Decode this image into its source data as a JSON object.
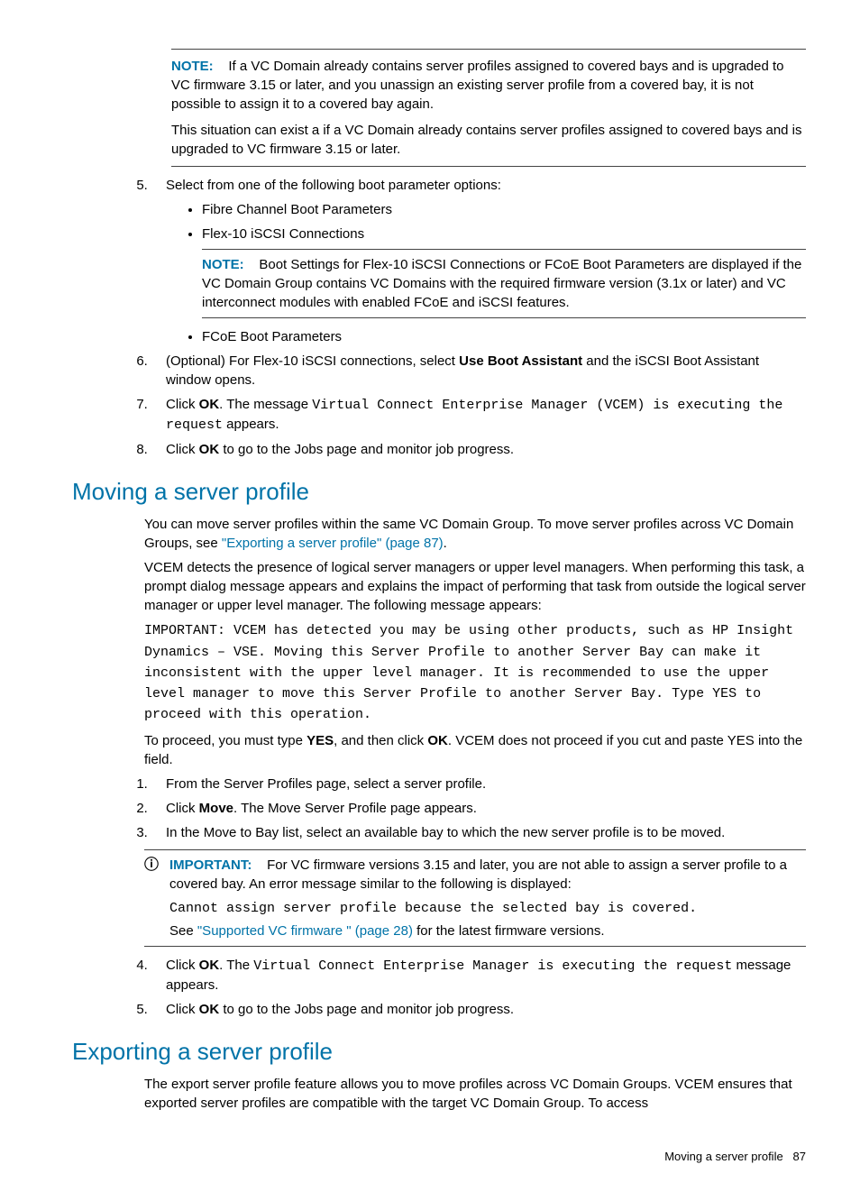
{
  "note1": {
    "label": "NOTE:",
    "p1_a": "If a VC Domain already contains server profiles assigned to covered bays and is upgraded to VC firmware 3.15 or later, and you unassign an existing server profile from a covered bay, it is not possible to assign it to a covered bay again.",
    "p2": "This situation can exist a if a VC Domain already contains server profiles assigned to covered bays and is upgraded to VC firmware 3.15 or later."
  },
  "step5": {
    "intro": "Select from one of the following boot parameter options:",
    "b1": "Fibre Channel Boot Parameters",
    "b2": "Flex-10 iSCSI Connections",
    "note_label": "NOTE:",
    "note_text": "Boot Settings for Flex-10 iSCSI Connections or FCoE Boot Parameters are displayed if the VC Domain Group contains VC Domains with the required firmware version (3.1x or later) and VC interconnect modules with enabled FCoE and iSCSI features.",
    "b3": "FCoE Boot Parameters"
  },
  "step6_a": "(Optional) For Flex-10 iSCSI connections, select ",
  "step6_b": "Use Boot Assistant",
  "step6_c": " and the iSCSI Boot Assistant window opens.",
  "step7_a": "Click ",
  "step7_ok": "OK",
  "step7_b": ". The message ",
  "step7_mono": "Virtual Connect Enterprise Manager (VCEM) is executing the request",
  "step7_c": " appears.",
  "step8_a": "Click ",
  "step8_b": " to go to the Jobs page and monitor job progress.",
  "moving": {
    "title": "Moving a server profile",
    "p1_a": "You can move server profiles within the same VC Domain Group. To move server profiles across VC Domain Groups, see ",
    "p1_link": "\"Exporting a server profile\" (page 87)",
    "p1_b": ".",
    "p2": "VCEM detects the presence of logical server managers or upper level managers. When performing this task, a prompt dialog message appears and explains the impact of performing that task from outside the logical server manager or upper level manager. The following message appears:",
    "mono": "IMPORTANT: VCEM has detected you may be using other products, such as HP Insight Dynamics – VSE. Moving this Server Profile to another Server Bay can make it inconsistent with the upper level manager. It is recommended to use the upper level manager to move this Server Profile to another Server Bay. Type YES to proceed with this operation.",
    "p3_a": "To proceed, you must type ",
    "p3_yes": "YES",
    "p3_b": ", and then click ",
    "p3_ok": "OK",
    "p3_c": ". VCEM does not proceed if you cut and paste YES into the field.",
    "s1": "From the Server Profiles page, select a server profile.",
    "s2_a": "Click ",
    "s2_b": "Move",
    "s2_c": ". The Move Server Profile page appears.",
    "s3": "In the Move to Bay list, select an available bay to which the new server profile is to be moved.",
    "imp_label": "IMPORTANT:",
    "imp_p1": "For VC firmware versions 3.15 and later, you are not able to assign a server profile to a covered bay. An error message similar to the following is displayed:",
    "imp_mono": "Cannot assign server profile because the selected bay is covered.",
    "imp_p2_a": "See ",
    "imp_link": "\"Supported VC firmware \" (page 28)",
    "imp_p2_b": " for the latest firmware versions.",
    "s4_a": "Click ",
    "s4_ok": "OK",
    "s4_b": ". The ",
    "s4_mono": "Virtual Connect Enterprise Manager is executing the request",
    "s4_c": " message appears.",
    "s5_a": "Click ",
    "s5_b": " to go to the Jobs page and monitor job progress."
  },
  "exporting": {
    "title": "Exporting a server profile",
    "p1": "The export server profile feature allows you to move profiles across VC Domain Groups. VCEM ensures that exported server profiles are compatible with the target VC Domain Group. To access"
  },
  "footer": {
    "text": "Moving a server profile",
    "page": "87"
  }
}
